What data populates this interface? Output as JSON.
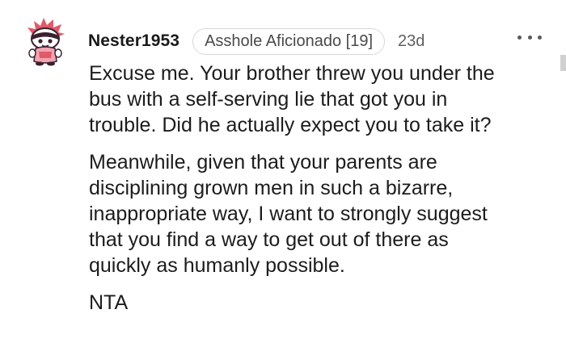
{
  "comment": {
    "author": "Nester1953",
    "flair": "Asshole Aficionado [19]",
    "age": "23d",
    "avatar_icon": "snoo-avatar-icon",
    "more_icon": "more-options-icon",
    "paragraphs": [
      "Excuse me. Your brother threw you under the\nbus with a self-serving lie that got you in\ntrouble. Did he actually expect you to take it?",
      "Meanwhile, given that your parents are\ndisciplining grown men in such a bizarre,\ninappropriate way, I want to strongly suggest\nthat you find a way to get out of there as\nquickly as humanly possible.",
      "NTA"
    ]
  },
  "colors": {
    "avatar_accent": "#e05a6a",
    "avatar_dark": "#3a2030",
    "text": "#1c1c1c",
    "flair_border": "#d8d8d8"
  }
}
